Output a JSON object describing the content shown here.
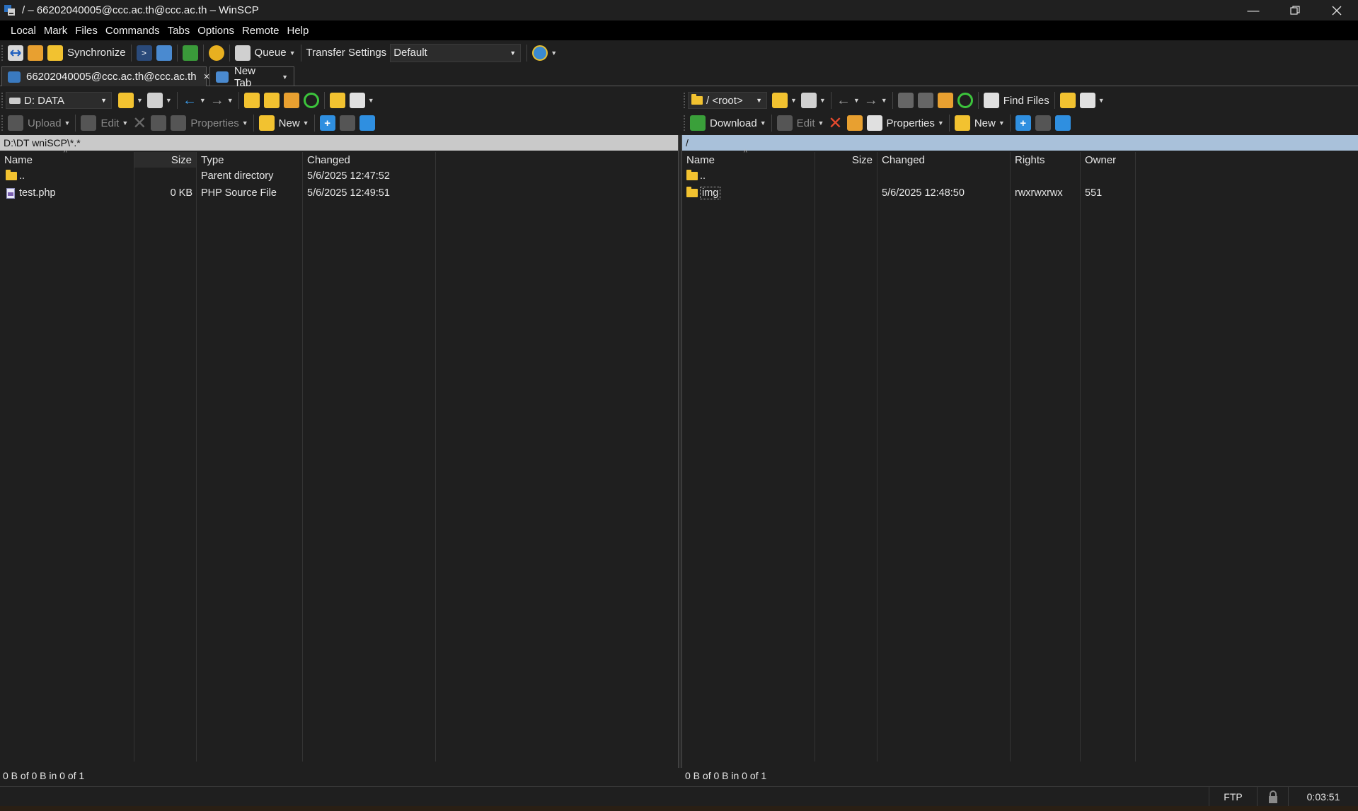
{
  "window": {
    "title": "/ – 66202040005@ccc.ac.th@ccc.ac.th – WinSCP"
  },
  "menu": [
    "Local",
    "Mark",
    "Files",
    "Commands",
    "Tabs",
    "Options",
    "Remote",
    "Help"
  ],
  "toolbar": {
    "synchronize_label": "Synchronize",
    "queue_label": "Queue",
    "transfer_settings_label": "Transfer Settings",
    "transfer_settings_value": "Default"
  },
  "tabs": [
    {
      "label": "66202040005@ccc.ac.th@ccc.ac.th",
      "close": "×"
    },
    {
      "label": "New Tab"
    }
  ],
  "local": {
    "drive": "D: DATA",
    "upload_label": "Upload",
    "edit_label": "Edit",
    "properties_label": "Properties",
    "new_label": "New",
    "path": "D:\\DT wniSCP\\*.*",
    "columns": [
      "Name",
      "Size",
      "Type",
      "Changed"
    ],
    "files": [
      {
        "name": "..",
        "size": "",
        "type": "Parent directory",
        "changed": "5/6/2025 12:47:52",
        "icon": "parent-folder-icon"
      },
      {
        "name": "test.php",
        "size": "0 KB",
        "type": "PHP Source File",
        "changed": "5/6/2025 12:49:51",
        "icon": "php-file-icon"
      }
    ],
    "status": "0 B of 0 B in 0 of 1"
  },
  "remote": {
    "location": "/ <root>",
    "download_label": "Download",
    "edit_label": "Edit",
    "properties_label": "Properties",
    "new_label": "New",
    "find_files_label": "Find Files",
    "path": "/",
    "columns": [
      "Name",
      "Size",
      "Changed",
      "Rights",
      "Owner"
    ],
    "files": [
      {
        "name": "..",
        "size": "",
        "changed": "",
        "rights": "",
        "owner": "",
        "icon": "parent-folder-icon"
      },
      {
        "name": "img",
        "size": "",
        "changed": "5/6/2025 12:48:50",
        "rights": "rwxrwxrwx",
        "owner": "551",
        "icon": "folder-icon"
      }
    ],
    "status": "0 B of 0 B in 0 of 1"
  },
  "statusbar": {
    "protocol": "FTP",
    "elapsed": "0:03:51"
  },
  "colors": {
    "background": "#1f1f1f",
    "remote_path_bar": "#a9c1da",
    "local_path_bar": "#c9c9c9",
    "folder": "#f2c230",
    "refresh_green": "#3cc43c",
    "delete_red": "#e64a2e",
    "add_blue": "#2f8fe0"
  }
}
